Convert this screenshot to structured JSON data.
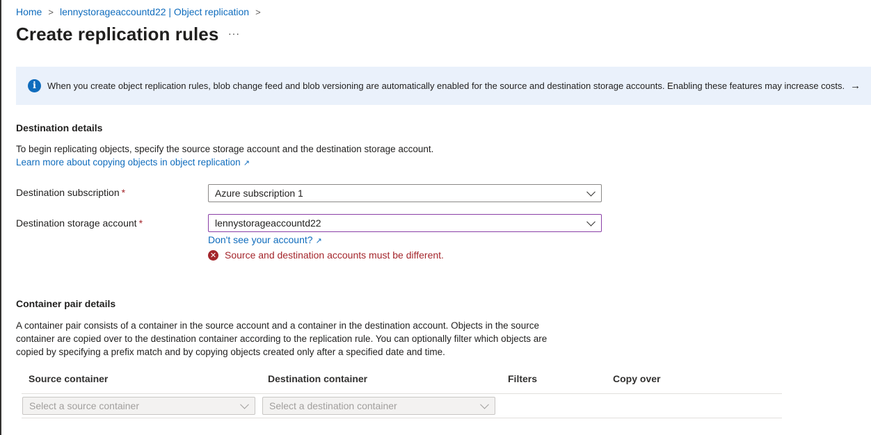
{
  "breadcrumb": {
    "home": "Home",
    "separator": ">",
    "parent": "lennystorageaccountd22 | Object replication"
  },
  "page": {
    "title": "Create replication rules",
    "more_label": "···"
  },
  "banner": {
    "icon": "info-icon",
    "message": "When you create object replication rules, blob change feed and blob versioning are automatically enabled for the source and destination storage accounts. Enabling these features may increase costs.",
    "arrow": "→"
  },
  "destination": {
    "heading": "Destination details",
    "description": "To begin replicating objects, specify the source storage account and the destination storage account.",
    "learn_more": "Learn more about copying objects in object replication",
    "subscription_label": "Destination subscription",
    "subscription_value": "Azure subscription 1",
    "account_label": "Destination storage account",
    "account_value": "lennystorageaccountd22",
    "required_marker": "*",
    "dont_see_link": "Don't see your account?",
    "error": "Source and destination accounts must be different."
  },
  "container": {
    "heading": "Container pair details",
    "description_lines": [
      "A container pair consists of a container in the source account and a container in the destination account. Objects in the source",
      "container are copied over to the destination container according to the replication rule. You can optionally filter which objects are",
      "copied by specifying a prefix match and by copying objects created only after a specified date and time."
    ],
    "columns": [
      "Source container",
      "Destination container",
      "Filters",
      "Copy over"
    ],
    "source_placeholder": "Select a source container",
    "destination_placeholder": "Select a destination container"
  },
  "colors": {
    "link": "#0f6cbd",
    "error": "#a4262c",
    "banner_bg": "#eaf1fb",
    "focus_border": "#8a3fa6"
  }
}
